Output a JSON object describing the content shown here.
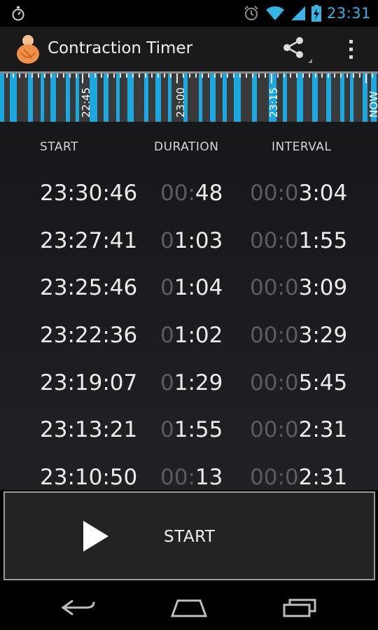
{
  "status_bar": {
    "time": "23:31",
    "icons": [
      "stopwatch-notification-icon",
      "alarm-icon",
      "wifi-icon",
      "cell-signal-icon",
      "battery-charging-icon"
    ]
  },
  "action_bar": {
    "title": "Contraction Timer",
    "icons": [
      "app-logo-icon",
      "share-icon",
      "overflow-menu-icon"
    ]
  },
  "timeline": {
    "labels": [
      "22:45",
      "23:00",
      "23:15",
      "NOW"
    ],
    "accent_color": "#1ba8e0"
  },
  "table": {
    "headers": [
      "START",
      "DURATION",
      "INTERVAL"
    ],
    "rows": [
      {
        "start": "23:30:46",
        "dur_dim": "00:",
        "dur": "48",
        "int_dim": "00:0",
        "int": "3:04"
      },
      {
        "start": "23:27:41",
        "dur_dim": "0",
        "dur": "1:03",
        "int_dim": "00:0",
        "int": "1:55"
      },
      {
        "start": "23:25:46",
        "dur_dim": "0",
        "dur": "1:04",
        "int_dim": "00:0",
        "int": "3:09"
      },
      {
        "start": "23:22:36",
        "dur_dim": "0",
        "dur": "1:02",
        "int_dim": "00:0",
        "int": "3:29"
      },
      {
        "start": "23:19:07",
        "dur_dim": "0",
        "dur": "1:29",
        "int_dim": "00:0",
        "int": "5:45"
      },
      {
        "start": "23:13:21",
        "dur_dim": "0",
        "dur": "1:55",
        "int_dim": "00:0",
        "int": "2:31"
      },
      {
        "start": "23:10:50",
        "dur_dim": "00:",
        "dur": "13",
        "int_dim": "00:0",
        "int": "2:31"
      }
    ]
  },
  "start_button": {
    "label": "START",
    "icon": "play-icon"
  },
  "nav_bar": {
    "icons": [
      "back-icon",
      "home-icon",
      "recent-apps-icon"
    ]
  }
}
